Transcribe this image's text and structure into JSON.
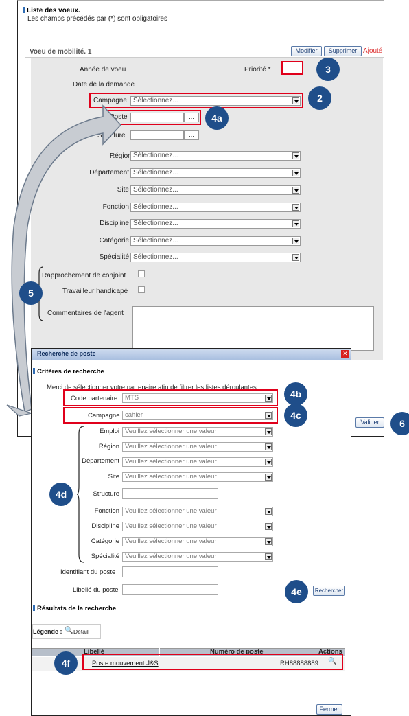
{
  "page": {
    "title": "Liste des voeux.",
    "required_note": "Les champs précédés par (*) sont obligatoires"
  },
  "voeu": {
    "header": "Voeu de mobilité. 1",
    "buttons": {
      "modifier": "Modifier",
      "supprimer": "Supprimer",
      "ajouter": "Ajouté"
    },
    "annee_label": "Année de voeu",
    "priorite_label": "Priorité *",
    "date_label": "Date de la demande",
    "campagne": {
      "label": "Campagne",
      "value": "Sélectionnez..."
    },
    "poste": {
      "label": "Poste",
      "button": "..."
    },
    "structure": {
      "label": "Structure",
      "button": "..."
    },
    "fields": [
      {
        "label": "Région",
        "value": "Sélectionnez..."
      },
      {
        "label": "Département",
        "value": "Sélectionnez..."
      },
      {
        "label": "Site",
        "value": "Sélectionnez..."
      },
      {
        "label": "Fonction",
        "value": "Sélectionnez..."
      },
      {
        "label": "Discipline",
        "value": "Sélectionnez..."
      },
      {
        "label": "Catégorie",
        "value": "Sélectionnez..."
      },
      {
        "label": "Spécialité",
        "value": "Sélectionnez..."
      }
    ],
    "rapprochement_label": "Rapprochement de conjoint",
    "handicap_label": "Travailleur handicapé",
    "commentaires_label": "Commentaires de l'agent",
    "valider": "Valider"
  },
  "dialog": {
    "title": "Recherche de poste",
    "criteres_title": "Critères de recherche",
    "intro": "Merci de sélectionner votre partenaire afin de filtrer les listes déroulantes",
    "code_partenaire": {
      "label": "Code partenaire",
      "value": "MTS"
    },
    "campagne": {
      "label": "Campagne",
      "value": "cahier"
    },
    "criteria": [
      {
        "label": "Emploi",
        "value": "Veuillez sélectionner une valeur"
      },
      {
        "label": "Région",
        "value": "Veuillez sélectionner une valeur"
      },
      {
        "label": "Département",
        "value": "Veuillez sélectionner une valeur"
      },
      {
        "label": "Site",
        "value": "Veuillez sélectionner une valeur"
      }
    ],
    "structure_label": "Structure",
    "criteria2": [
      {
        "label": "Fonction",
        "value": "Veuillez sélectionner une valeur"
      },
      {
        "label": "Discipline",
        "value": "Veuillez sélectionner une valeur"
      },
      {
        "label": "Catégorie",
        "value": "Veuillez sélectionner une valeur"
      },
      {
        "label": "Spécialité",
        "value": "Veuillez sélectionner une valeur"
      }
    ],
    "identifiant_label": "Identifiant du poste",
    "libelle_label": "Libellé du poste",
    "rechercher": "Rechercher",
    "resultats_title": "Résultats de la recherche",
    "legende_label": "Légende :",
    "detail_label": "Détail",
    "table": {
      "headers": [
        "Libellé",
        "Numéro de poste",
        "Actions"
      ],
      "rows": [
        {
          "libelle": "Poste mouvement J&S",
          "numero": "RH88888889"
        }
      ]
    },
    "fermer": "Fermer"
  },
  "annotations": {
    "a2": "2",
    "a3": "3",
    "a4a": "4a",
    "a4b": "4b",
    "a4c": "4c",
    "a4d": "4d",
    "a4e": "4e",
    "a4f": "4f",
    "a5": "5",
    "a6": "6"
  },
  "colors": {
    "annotation_badge": "#1f4e8a",
    "highlight": "#e0001b",
    "accent": "#2f6db5"
  }
}
